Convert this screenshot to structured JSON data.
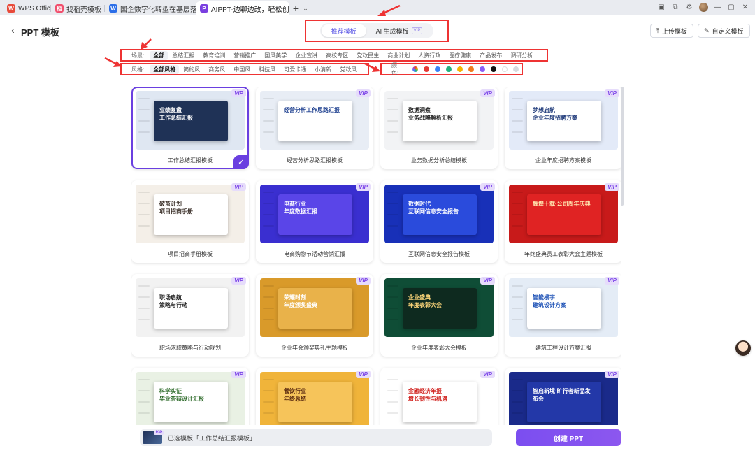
{
  "tabs": [
    {
      "label": "WPS Office",
      "icon": "wps-icon",
      "color": "#e84a3a"
    },
    {
      "label": "找稻壳模板",
      "icon": "docer-icon",
      "color": "#f0506e"
    },
    {
      "label": "国企数字化转型在基层落地难点与对",
      "icon": "word-doc-icon",
      "color": "#2b6ee8"
    },
    {
      "label": "AIPPT-边聊边改，轻松创作",
      "icon": "aippt-icon",
      "color": "#7a3fe0"
    }
  ],
  "header": {
    "title": "PPT 模板",
    "segments": [
      "推荐模板",
      "AI 生成模板"
    ],
    "segment_badge": "VIP",
    "upload_label": "上传模板",
    "custom_label": "自定义模板"
  },
  "filters": {
    "scene_label": "场景:",
    "scenes": [
      "全部",
      "总结汇报",
      "教育培训",
      "营销推广",
      "国风美学",
      "企业宣讲",
      "高校专区",
      "党政民生",
      "商业计划",
      "人资行政",
      "医疗健康",
      "产品发布",
      "调研分析"
    ],
    "style_label": "风格:",
    "styles": [
      "全部风格",
      "简约风",
      "商务风",
      "中国风",
      "科技风",
      "可爱卡通",
      "小清新",
      "党政风"
    ],
    "color_label": "颜色:",
    "colors": [
      "#e53935",
      "#3b82f6",
      "#22b07d",
      "#f5b400",
      "#f07a1c",
      "#8b5cf6",
      "#111111",
      "#ffffff",
      "#d7d9de"
    ]
  },
  "vip_badge": "VIP",
  "cards": [
    {
      "name": "工作总结汇报模板",
      "thumb": "业绩复盘\n工作总结汇报",
      "bg": "#dfe7f2",
      "panel": "#1f3256",
      "fg": "#ffffff",
      "selected": true
    },
    {
      "name": "经营分析思路汇报模板",
      "thumb": "经营分析工作思路汇报",
      "bg": "#e8edf5",
      "panel": "#ffffff",
      "fg": "#1d3f8f"
    },
    {
      "name": "业务数据分析总结模板",
      "thumb": "数据洞察\n业务战略解析汇报",
      "bg": "#f2f3f5",
      "panel": "#ffffff",
      "fg": "#222222"
    },
    {
      "name": "企业年度招聘方案模板",
      "thumb": "梦想启航\n企业年度招聘方案",
      "bg": "#e3eaf8",
      "panel": "#ffffff",
      "fg": "#1f3a7a"
    },
    {
      "name": "项目招商手册模板",
      "thumb": "破茧计划\n项目招商手册",
      "bg": "#f4efe8",
      "panel": "#ffffff",
      "fg": "#3a2f28"
    },
    {
      "name": "电商购物节活动营销汇报",
      "thumb": "电商行业\n年度数据汇报",
      "bg": "#3a2fd0",
      "panel": "#5a45e8",
      "fg": "#ffffff"
    },
    {
      "name": "互联网信息安全报告模板",
      "thumb": "数据时代\n互联网信息安全报告",
      "bg": "#1830b8",
      "panel": "#2a4bdc",
      "fg": "#ffffff"
    },
    {
      "name": "年终盛典员工表彰大会主题模板",
      "thumb": "辉煌十载·公司周年庆典",
      "bg": "#c81a1a",
      "panel": "#e02323",
      "fg": "#ffe6b0"
    },
    {
      "name": "职场求职策略与行动规划",
      "thumb": "职场启航\n策略与行动",
      "bg": "#f2f2f2",
      "panel": "#ffffff",
      "fg": "#222222"
    },
    {
      "name": "企业年会颁奖典礼主题模板",
      "thumb": "荣耀时刻\n年度颁奖盛典",
      "bg": "#d99a2a",
      "panel": "#e9b24a",
      "fg": "#ffffff"
    },
    {
      "name": "企业年度表彰大会模板",
      "thumb": "企业盛典\n年度表彰大会",
      "bg": "#0f4d36",
      "panel": "#0e2a1f",
      "fg": "#ffd77a"
    },
    {
      "name": "建筑工程设计方案汇报",
      "thumb": "智能楼宇\n建筑设计方案",
      "bg": "#e4ecf6",
      "panel": "#ffffff",
      "fg": "#1a4fb5"
    },
    {
      "name": "",
      "thumb": "科学实证\n毕业答辩设计汇报",
      "bg": "#e9f1e4",
      "panel": "#ffffff",
      "fg": "#2e6b2a"
    },
    {
      "name": "",
      "thumb": "餐饮行业\n年终总结",
      "bg": "#f0b43a",
      "panel": "#f6c45a",
      "fg": "#5a2a10"
    },
    {
      "name": "",
      "thumb": "金融经济年报\n增长韧性与机遇",
      "bg": "#ffffff",
      "panel": "#ffffff",
      "fg": "#d1231f"
    },
    {
      "name": "",
      "thumb": "智启新境·旷行者新品发布会",
      "bg": "#1a2a8a",
      "panel": "#2338a8",
      "fg": "#ffffff"
    }
  ],
  "bottom": {
    "selected_text": "已选模板「工作总结汇报模板」",
    "create_label": "创建 PPT"
  }
}
